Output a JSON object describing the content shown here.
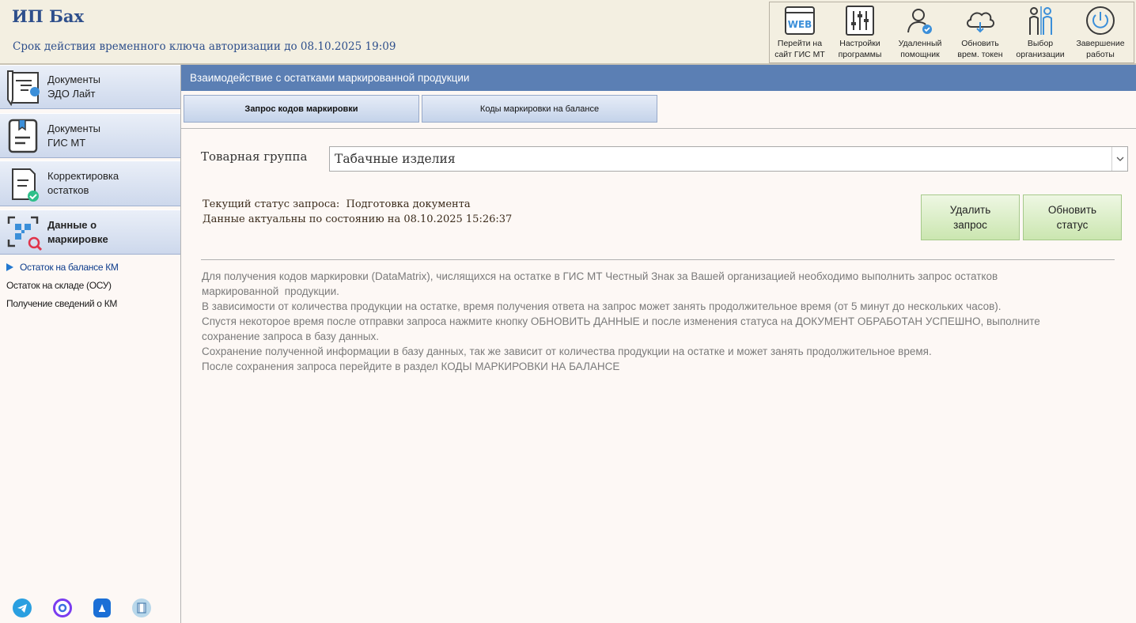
{
  "header": {
    "title": "ИП Бах",
    "subtitle": "Срок действия временного ключа авторизации до 08.10.2025 19:09"
  },
  "toolbar": [
    {
      "line1": "Перейти на",
      "line2": "сайт ГИС МТ",
      "icon": "web-icon"
    },
    {
      "line1": "Настройки",
      "line2": "программы",
      "icon": "settings-sliders-icon"
    },
    {
      "line1": "Удаленный",
      "line2": "помощник",
      "icon": "remote-user-icon"
    },
    {
      "line1": "Обновить",
      "line2": "врем. токен",
      "icon": "cloud-refresh-icon"
    },
    {
      "line1": "Выбор",
      "line2": "организации",
      "icon": "people-icon"
    },
    {
      "line1": "Завершение",
      "line2": "работы",
      "icon": "power-icon"
    }
  ],
  "sidebar": {
    "nav": [
      {
        "line1": "Документы",
        "line2": "ЭДО Лайт",
        "icon": "edo-document-icon"
      },
      {
        "line1": "Документы",
        "line2": "ГИС МТ",
        "icon": "gis-document-icon"
      },
      {
        "line1": "Корректировка",
        "line2": "остатков",
        "icon": "correction-doc-icon"
      },
      {
        "line1": "Данные о",
        "line2": "маркировке",
        "icon": "qr-search-icon"
      }
    ],
    "sub_items": [
      {
        "label": "Остаток на балансе КМ",
        "active": true
      },
      {
        "label": "Остаток на складе (ОСУ)",
        "active": false
      },
      {
        "label": "Получение сведений о КМ",
        "active": false
      }
    ],
    "social": [
      "telegram-icon",
      "max-messenger-icon",
      "dzen-icon",
      "video-icon"
    ]
  },
  "main": {
    "banner": "Взаимодействие с остатками маркированной продукции",
    "tabs": [
      {
        "label": "Запрос кодов маркировки",
        "active": true
      },
      {
        "label": "Коды маркировки на балансе",
        "active": false
      }
    ],
    "product_group_label": "Товарная группа",
    "product_group_value": "Табачные изделия",
    "status_label": "Текущий статус запроса:",
    "status_value": "Подготовка документа",
    "data_date_label": "Данные актуальны по состоянию на",
    "data_date_value": "08.10.2025 15:26:37",
    "delete_button": {
      "line1": "Удалить",
      "line2": "запрос"
    },
    "refresh_button": {
      "line1": "Обновить",
      "line2": "статус"
    },
    "info_lines": [
      "Для получения кодов маркировки (DataMatrix), числящихся на остатке в ГИС МТ Честный Знак за Вашей организацией необходимо выполнить запрос остатков",
      "маркированной  продукции.",
      "В зависимости от количества продукции на остатке, время получения ответа на запрос может занять продолжительное время (от 5 минут до нескольких часов).",
      "Спустя некоторое время после отправки запроса нажмите кнопку ОБНОВИТЬ ДАННЫЕ и после изменения статуса на ДОКУМЕНТ ОБРАБОТАН УСПЕШНО, выполните",
      "сохранение запроса в базу данных.",
      "Сохранение полученной информации в базу данных, так же зависит от количества продукции на остатке и может занять продолжительное время.",
      "После сохранения запроса перейдите в раздел КОДЫ МАРКИРОВКИ НА БАЛАНСЕ"
    ]
  },
  "colors": {
    "title_blue": "#2e4f8c",
    "banner_blue": "#5b7fb4",
    "sidebar_active_arrow": "#2378d0",
    "button_green": "#cbe6b0"
  }
}
